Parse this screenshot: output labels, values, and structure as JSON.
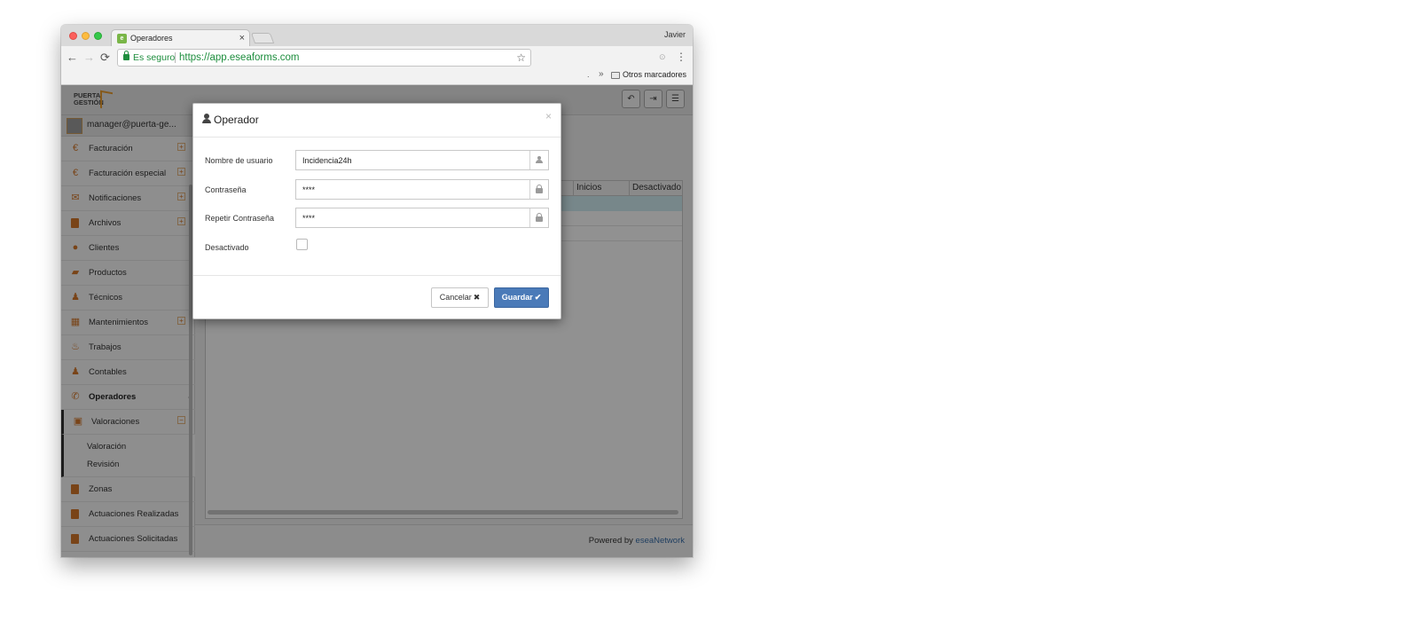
{
  "browser": {
    "tab_title": "Operadores",
    "tab_close": "×",
    "favicon": "e",
    "profile": "Javier",
    "secure_label": "Es seguro",
    "url": "https://app.eseaforms.com",
    "bookmarks_dot": ".",
    "bookmarks_chevron": "»",
    "bookmarks_folder": "Otros marcadores"
  },
  "app": {
    "logo_line1": "PUERTA",
    "logo_line2": "GESTIÓN",
    "header_buttons": [
      "undo-icon",
      "logout-icon",
      "menu-icon"
    ],
    "user": "manager@puerta-ge...",
    "menu": [
      {
        "label": "Facturación",
        "icon": "euro-icon",
        "expandable": true
      },
      {
        "label": "Facturación especial",
        "icon": "euro-icon",
        "expandable": true
      },
      {
        "label": "Notificaciones",
        "icon": "envelope-icon",
        "expandable": true
      },
      {
        "label": "Archivos",
        "icon": "book-icon",
        "expandable": true
      },
      {
        "label": "Clientes",
        "icon": "users-icon",
        "expandable": false
      },
      {
        "label": "Productos",
        "icon": "cart-icon",
        "expandable": false
      },
      {
        "label": "Técnicos",
        "icon": "person-icon",
        "expandable": false
      },
      {
        "label": "Mantenimientos",
        "icon": "calendar-icon",
        "expandable": true
      },
      {
        "label": "Trabajos",
        "icon": "fire-icon",
        "expandable": false
      },
      {
        "label": "Contables",
        "icon": "person-icon",
        "expandable": false
      },
      {
        "label": "Operadores",
        "icon": "phone-icon",
        "expandable": false,
        "active": true
      },
      {
        "label": "Valoraciones",
        "icon": "money-icon",
        "expandable": true,
        "open": true
      },
      {
        "label": "Zonas",
        "icon": "file-icon",
        "expandable": false
      },
      {
        "label": "Actuaciones Realizadas",
        "icon": "file-icon",
        "expandable": false
      },
      {
        "label": "Actuaciones Solicitadas",
        "icon": "file-icon",
        "expandable": false
      }
    ],
    "submenu": [
      "Valoración",
      "Revisión"
    ],
    "grid_columns": [
      "Inicios",
      "Desactivado"
    ],
    "footer_prefix": "Powered by",
    "footer_link": "eseaNetwork",
    "accent_color": "#d0762a"
  },
  "modal": {
    "title": "Operador",
    "close": "×",
    "fields": [
      {
        "label": "Nombre de usuario",
        "value": "Incidencia24h",
        "icon": "user-icon"
      },
      {
        "label": "Contraseña",
        "value": "****",
        "icon": "lock-icon"
      },
      {
        "label": "Repetir Contraseña",
        "value": "****",
        "icon": "lock-icon"
      }
    ],
    "checkbox_label": "Desactivado",
    "checkbox_checked": false,
    "cancel_label": "Cancelar",
    "cancel_icon": "✖",
    "save_label": "Guardar",
    "save_icon": "✔",
    "save_color": "#4a7ab8"
  }
}
